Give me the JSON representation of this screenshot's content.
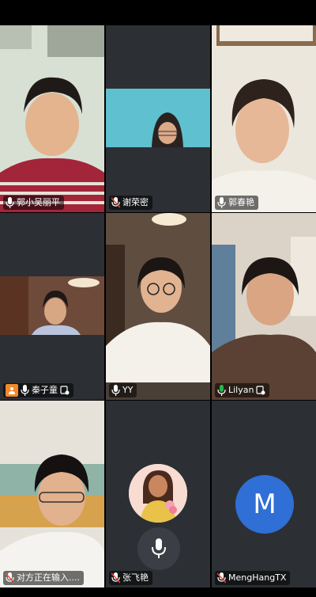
{
  "participants": [
    {
      "name": "郭小吴丽平",
      "mic": "on",
      "badge": false
    },
    {
      "name": "谢荣密",
      "mic": "muted",
      "badge": false
    },
    {
      "name": "郭春艳",
      "mic": "on",
      "badge": false
    },
    {
      "name": "秦子童",
      "mic": "on",
      "badge": true,
      "share": true
    },
    {
      "name": "YY",
      "mic": "on",
      "badge": false
    },
    {
      "name": "Lilyan",
      "mic": "speaking",
      "badge": true
    },
    {
      "name": "对方正在输入....",
      "mic": "muted",
      "badge": false
    },
    {
      "name": "张飞艳",
      "mic": "muted",
      "badge": false
    },
    {
      "name": "MengHangTX",
      "mic": "muted",
      "badge": false
    }
  ],
  "avatar_letter": "M",
  "colors": {
    "tile_bg": "#2c2f34",
    "active_border": "#27b54a",
    "avatar_blue": "#2f6fd6",
    "mic_muted": "#e5483a",
    "share_orange": "#f08a2c"
  }
}
